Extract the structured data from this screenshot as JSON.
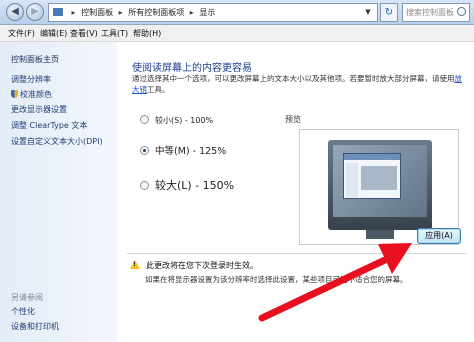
{
  "address_bar": {
    "back_icon": "back-arrow-icon",
    "forward_icon": "forward-arrow-icon",
    "path": [
      "控制面板",
      "所有控制面板项",
      "显示"
    ],
    "refresh_icon": "refresh-icon",
    "search_placeholder": "搜索控制面板"
  },
  "menubar": {
    "items": [
      "文件(F)",
      "编辑(E)",
      "查看(V)",
      "工具(T)",
      "帮助(H)"
    ]
  },
  "sidebar": {
    "home": "控制面板主页",
    "links": [
      "调整分辨率",
      "校准颜色",
      "更改显示器设置",
      "调整 ClearType 文本",
      "设置自定义文本大小(DPI)"
    ],
    "see_also_label": "另请参阅",
    "see_also_links": [
      "个性化",
      "设备和打印机"
    ]
  },
  "main": {
    "title": "使阅读屏幕上的内容更容易",
    "description": "通过选择其中一个选项，可以更改屏幕上的文本大小以及其他项。若要暂时放大部分屏幕，请使用",
    "description_link": "放大镜",
    "description_tail": "工具。",
    "options": [
      {
        "label": "较小(S) - 100%",
        "selected": false
      },
      {
        "label": "中等(M) - 125%",
        "selected": true
      },
      {
        "label": "较大(L) - 150%",
        "selected": false
      }
    ],
    "preview_label": "预览",
    "warning": "此更改将在您下次登录时生效。",
    "note": "如果在将显示器设置为该分辨率时选择此设置，某些项目可能不适合您的屏幕。",
    "apply_button": "应用(A)"
  },
  "annotation": {
    "arrow_color": "#e8101e"
  }
}
